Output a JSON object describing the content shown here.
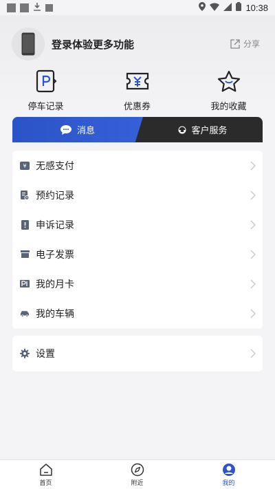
{
  "status_bar": {
    "time": "10:38"
  },
  "header": {
    "login_prompt": "登录体验更多功能",
    "share_label": "分享"
  },
  "quick_actions": [
    {
      "label": "停车记录",
      "icon": "parking-record-icon"
    },
    {
      "label": "优惠券",
      "icon": "coupon-icon"
    },
    {
      "label": "我的收藏",
      "icon": "favorites-star-icon"
    }
  ],
  "tabs": {
    "messages_label": "消息",
    "service_label": "客户服务",
    "active_color": "#2c53c8"
  },
  "menu": {
    "items": [
      {
        "label": "无感支付",
        "icon": "payment-icon"
      },
      {
        "label": "预约记录",
        "icon": "reservation-icon"
      },
      {
        "label": "申诉记录",
        "icon": "appeal-icon"
      },
      {
        "label": "电子发票",
        "icon": "invoice-icon"
      },
      {
        "label": "我的月卡",
        "icon": "monthly-card-icon"
      },
      {
        "label": "我的车辆",
        "icon": "car-icon"
      }
    ],
    "settings_label": "设置"
  },
  "bottom_nav": {
    "items": [
      {
        "label": "首页",
        "icon": "home-icon",
        "active": false
      },
      {
        "label": "附近",
        "icon": "compass-icon",
        "active": false
      },
      {
        "label": "我的",
        "icon": "profile-icon",
        "active": true
      }
    ]
  }
}
